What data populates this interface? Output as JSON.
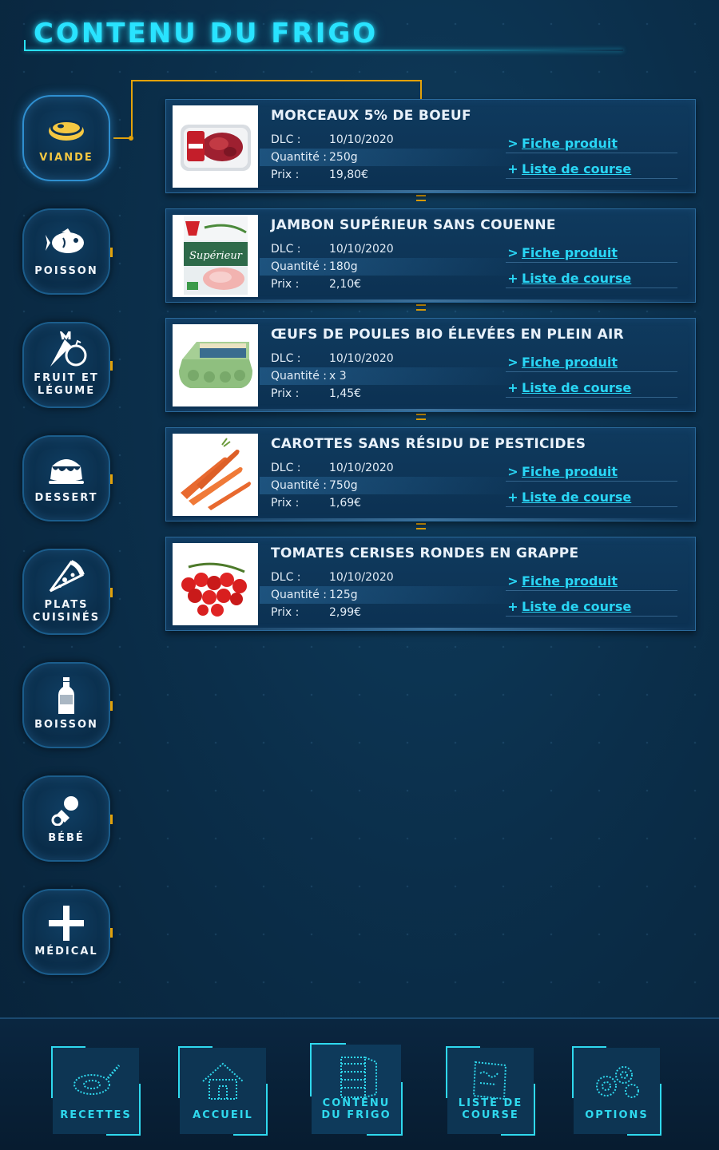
{
  "header": {
    "title": "CONTENU DU FRIGO"
  },
  "categories": [
    {
      "label": "VIANDE",
      "icon": "steak-icon",
      "active": true
    },
    {
      "label": "POISSON",
      "icon": "fish-icon"
    },
    {
      "label": "FRUIT ET\nLÉGUME",
      "icon": "fruit-vegetable-icon"
    },
    {
      "label": "DESSERT",
      "icon": "dessert-icon"
    },
    {
      "label": "PLATS\nCUISINÉS",
      "icon": "pizza-slice-icon"
    },
    {
      "label": "BOISSON",
      "icon": "bottle-icon"
    },
    {
      "label": "BÉBÉ",
      "icon": "pacifier-icon"
    },
    {
      "label": "MÉDICAL",
      "icon": "medical-cross-icon"
    }
  ],
  "products": [
    {
      "name": "MORCEAUX 5% DE BOEUF",
      "image": "beef-pack-image",
      "dlc_label": "DLC :",
      "dlc": "10/10/2020",
      "qty_label": "Quantité :",
      "qty": "250g",
      "price_label": "Prix :",
      "price": "19,80€",
      "fiche_symbol": ">",
      "fiche_label": "Fiche produit",
      "liste_symbol": "+",
      "liste_label": "Liste de course"
    },
    {
      "name": "JAMBON SUPÉRIEUR SANS COUENNE",
      "image": "ham-pack-image",
      "dlc_label": "DLC :",
      "dlc": "10/10/2020",
      "qty_label": "Quantité :",
      "qty": "180g",
      "price_label": "Prix :",
      "price": "2,10€",
      "fiche_symbol": ">",
      "fiche_label": "Fiche produit",
      "liste_symbol": "+",
      "liste_label": "Liste de course"
    },
    {
      "name": "ŒUFS DE POULES BIO ÉLEVÉES EN PLEIN AIR",
      "image": "egg-box-image",
      "dlc_label": "DLC :",
      "dlc": "10/10/2020",
      "qty_label": "Quantité :",
      "qty": "x 3",
      "price_label": "Prix :",
      "price": "1,45€",
      "fiche_symbol": ">",
      "fiche_label": "Fiche produit",
      "liste_symbol": "+",
      "liste_label": "Liste de course"
    },
    {
      "name": "CAROTTES SANS RÉSIDU DE PESTICIDES",
      "image": "carrots-image",
      "dlc_label": "DLC :",
      "dlc": "10/10/2020",
      "qty_label": "Quantité :",
      "qty": "750g",
      "price_label": "Prix :",
      "price": "1,69€",
      "fiche_symbol": ">",
      "fiche_label": "Fiche produit",
      "liste_symbol": "+",
      "liste_label": "Liste de course"
    },
    {
      "name": "TOMATES CERISES RONDES EN GRAPPE",
      "image": "cherry-tomatoes-image",
      "dlc_label": "DLC :",
      "dlc": "10/10/2020",
      "qty_label": "Quantité :",
      "qty": "125g",
      "price_label": "Prix :",
      "price": "2,99€",
      "fiche_symbol": ">",
      "fiche_label": "Fiche produit",
      "liste_symbol": "+",
      "liste_label": "Liste de course"
    }
  ],
  "nav": [
    {
      "label": "RECETTES",
      "icon": "pan-icon"
    },
    {
      "label": "ACCUEIL",
      "icon": "house-icon"
    },
    {
      "label": "CONTENU\nDU FRIGO",
      "icon": "fridge-icon",
      "active": true
    },
    {
      "label": "LISTE DE\nCOURSE",
      "icon": "note-icon"
    },
    {
      "label": "OPTIONS",
      "icon": "gears-icon"
    }
  ],
  "colors": {
    "accent": "#29e3ff",
    "gold": "#e3a20a",
    "active_label": "#f5c842",
    "link": "#29d6f5"
  }
}
